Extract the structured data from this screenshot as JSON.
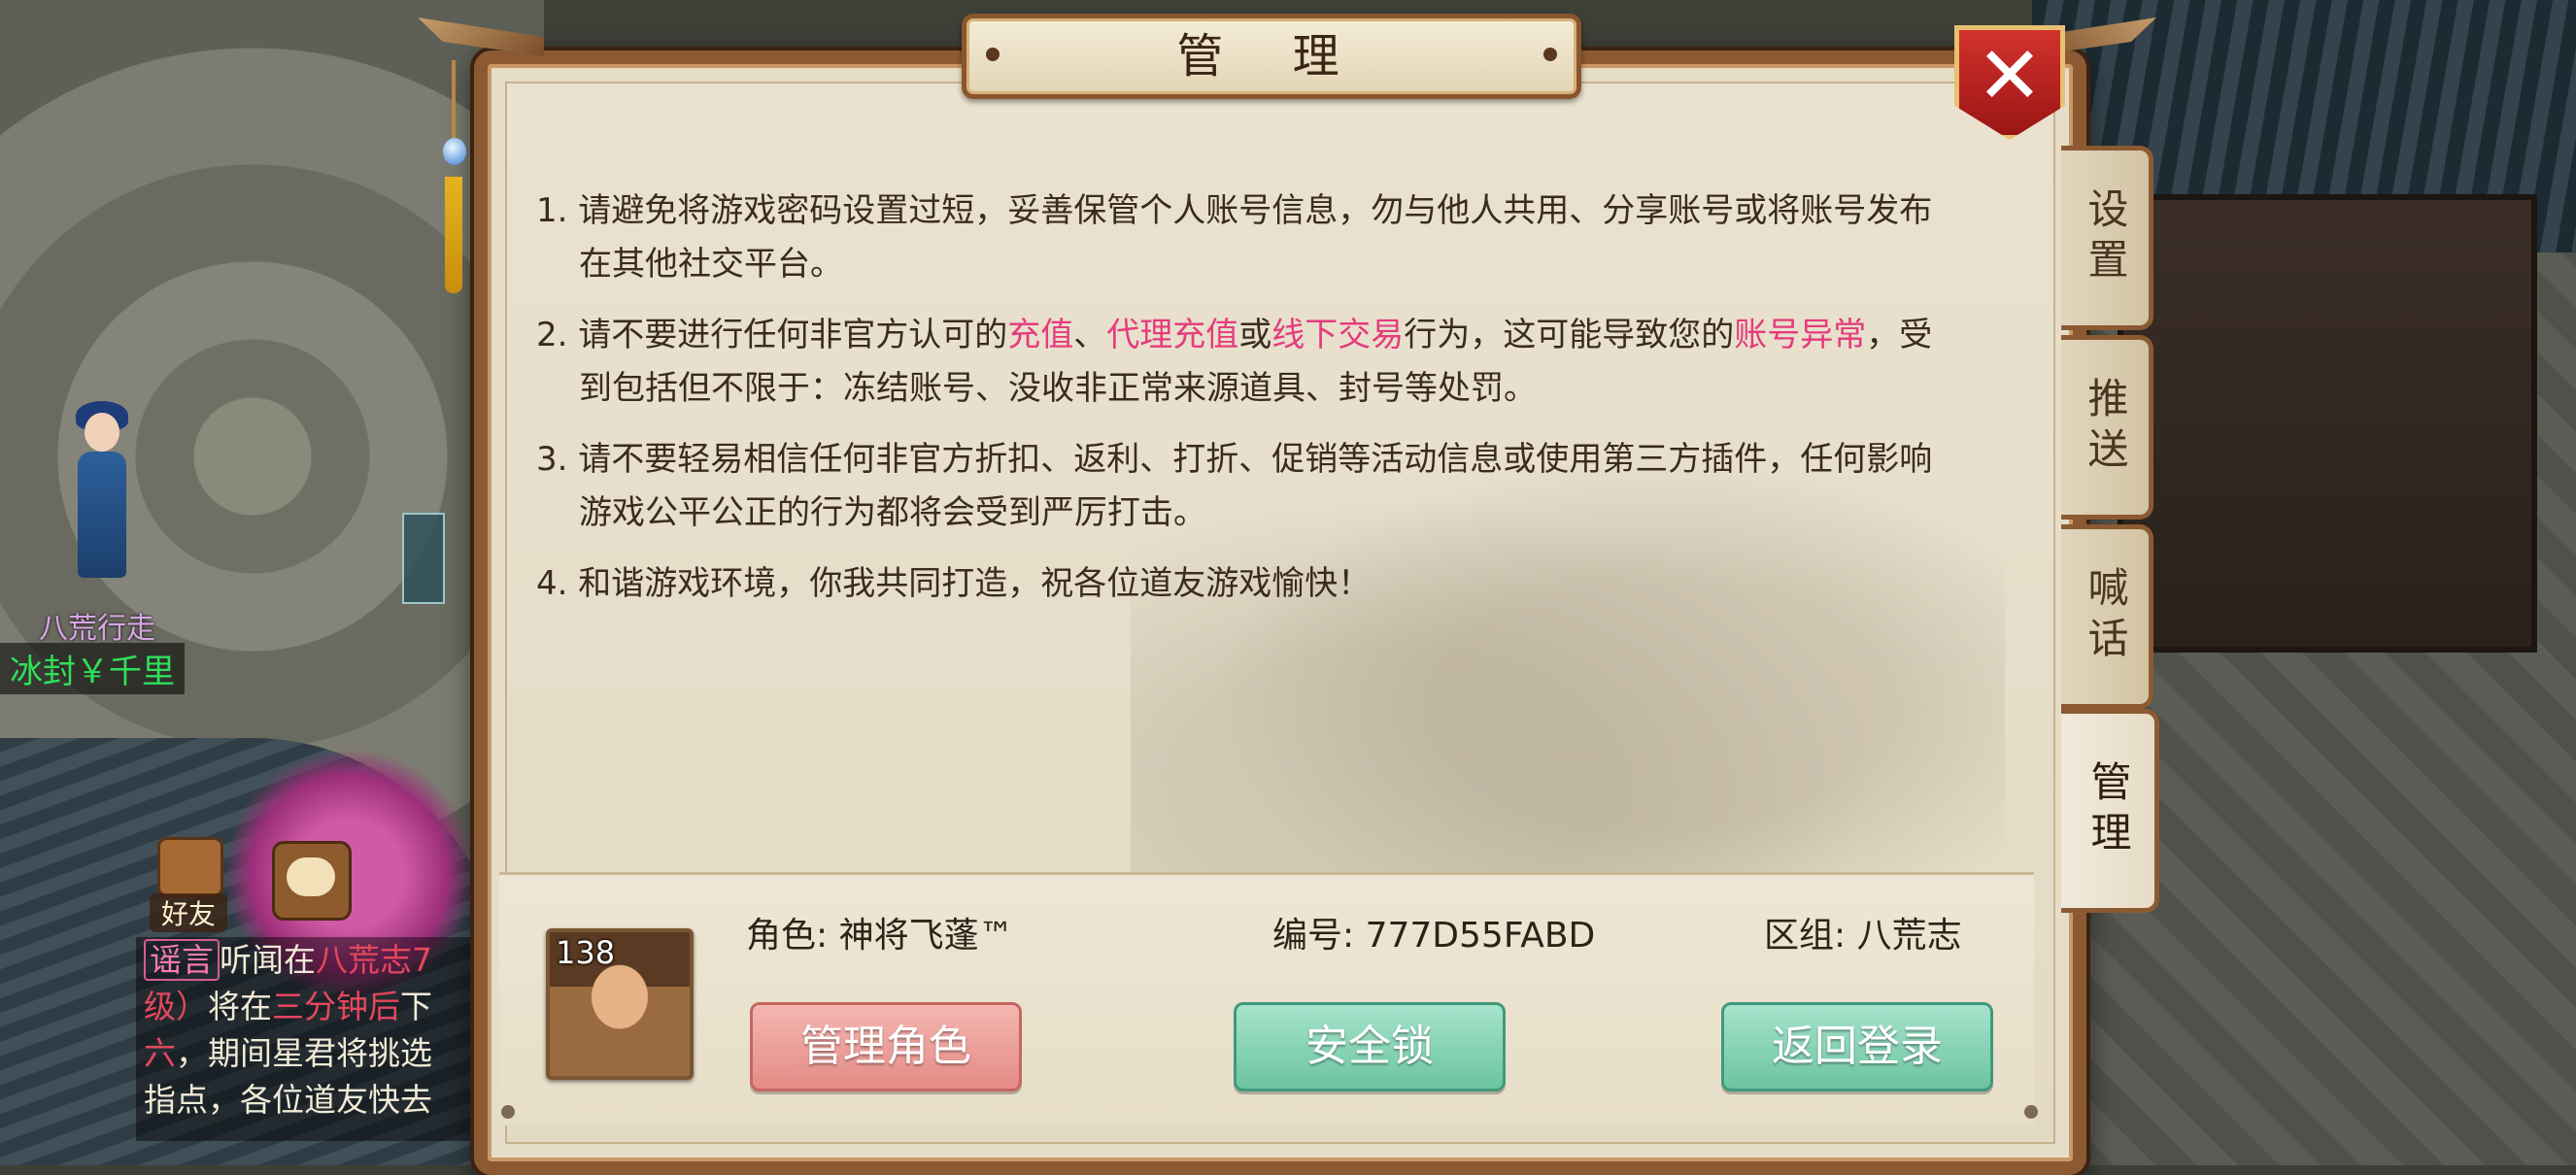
{
  "dialog": {
    "title": "管 理",
    "close_symbol": "✕"
  },
  "notices": [
    {
      "num": "1.",
      "segments": [
        {
          "text": "请避免将游戏密码设置过短，妥善保管个人账号信息，勿与他人共用、分享账号或将账号发布在其他社交平台。",
          "highlight": false
        }
      ]
    },
    {
      "num": "2.",
      "segments": [
        {
          "text": "请不要进行任何非官方认可的",
          "highlight": false
        },
        {
          "text": "充值",
          "highlight": true
        },
        {
          "text": "、",
          "highlight": false
        },
        {
          "text": "代理充值",
          "highlight": true
        },
        {
          "text": "或",
          "highlight": false
        },
        {
          "text": "线下交易",
          "highlight": true
        },
        {
          "text": "行为，这可能导致您的",
          "highlight": false
        },
        {
          "text": "账号异常",
          "highlight": true
        },
        {
          "text": "，受到包括但不限于：冻结账号、没收非正常来源道具、封号等处罚。",
          "highlight": false
        }
      ]
    },
    {
      "num": "3.",
      "segments": [
        {
          "text": "请不要轻易相信任何非官方折扣、返利、打折、促销等活动信息或使用第三方插件，任何影响游戏公平公正的行为都将会受到严厉打击。",
          "highlight": false
        }
      ]
    },
    {
      "num": "4.",
      "segments": [
        {
          "text": "和谐游戏环境，你我共同打造，祝各位道友游戏愉快！",
          "highlight": false
        }
      ]
    }
  ],
  "tabs": [
    {
      "label": "设置",
      "active": false
    },
    {
      "label": "推送",
      "active": false
    },
    {
      "label": "喊话",
      "active": false
    },
    {
      "label": "管理",
      "active": true
    }
  ],
  "player": {
    "level": "138",
    "role_text": "角色: 神将飞蓬™",
    "id_text": "编号: 777D55FABD",
    "zone_text": "区组: 八荒志"
  },
  "buttons": {
    "manage_role": "管理角色",
    "security_lock": "安全锁",
    "back_login": "返回登录"
  },
  "background": {
    "npc_name": "八荒行走",
    "npc_title": "冰封￥千里",
    "friend_label": "好友",
    "chat": {
      "tag": "谣言",
      "line1": "听闻在",
      "line1_red": "八荒志7",
      "line2_red": "级）",
      "line2": "将在",
      "line2_red2": "三分钟后",
      "line2_end": "下",
      "line3_red": "六",
      "line3": "，期间星君将挑选",
      "line4": "指点，各位道友快去"
    }
  },
  "colors": {
    "highlight": "#e63b7c",
    "text": "#3a2b1f",
    "frame": "#8b5a32",
    "close_red": "#c22a25",
    "button_pink": "#e9a09b",
    "button_green": "#86d1b4"
  }
}
